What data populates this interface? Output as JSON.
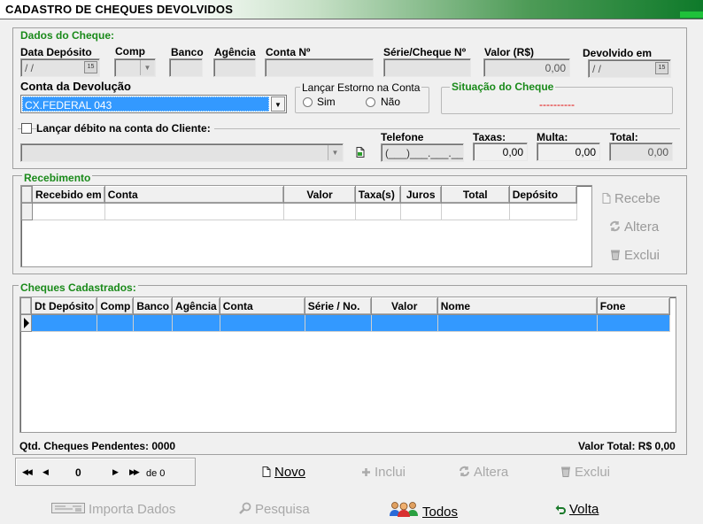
{
  "window": {
    "title": "CADASTRO DE CHEQUES DEVOLVIDOS"
  },
  "cheque": {
    "group_title": "Dados do Cheque:",
    "labels": {
      "data_deposito": "Data Depósito",
      "comp": "Comp",
      "banco": "Banco",
      "agencia": "Agência",
      "conta": "Conta Nº",
      "serie": "Série/Cheque Nº",
      "valor": "Valor (R$)",
      "devolvido": "Devolvido em"
    },
    "values": {
      "data_deposito": "/ /",
      "comp": "",
      "banco": "",
      "agencia": "",
      "conta": "",
      "serie": "",
      "valor": "0,00",
      "devolvido": "/ /"
    },
    "conta_devolucao_label": "Conta da Devolução",
    "conta_devolucao_value": "CX.FEDERAL 043",
    "estorno": {
      "title": "Lançar Estorno na Conta",
      "sim": "Sim",
      "nao": "Não"
    },
    "situacao": {
      "title": "Situação do Cheque",
      "value": "----------"
    }
  },
  "debito": {
    "checkbox_label": "Lançar débito na conta do Cliente:",
    "labels": {
      "telefone": "Telefone",
      "taxas": "Taxas:",
      "multa": "Multa:",
      "total": "Total:"
    },
    "values": {
      "telefone": "(___)___.___.___",
      "taxas": "0,00",
      "multa": "0,00",
      "total": "0,00"
    }
  },
  "recebimento": {
    "group_title": "Recebimento",
    "columns": [
      "Recebido em",
      "Conta",
      "Valor",
      "Taxa(s)",
      "Juros",
      "Total",
      "Depósito"
    ],
    "buttons": {
      "recebe": "Recebe",
      "altera": "Altera",
      "exclui": "Exclui"
    }
  },
  "cadastrados": {
    "group_title": "Cheques Cadastrados:",
    "columns": [
      "Dt Depósito",
      "Comp",
      "Banco",
      "Agência",
      "Conta",
      "Série / No.",
      "Valor",
      "Nome",
      "Fone"
    ],
    "pendentes": "Qtd. Cheques Pendentes: 0000",
    "valor_total": "Valor Total: R$ 0,00"
  },
  "navigator": {
    "first": "◀◀",
    "prev": "◀",
    "current": "0",
    "next": "▶",
    "last": "▶▶",
    "of": "de 0"
  },
  "actions": {
    "novo": "Novo",
    "inclui": "Inclui",
    "altera": "Altera",
    "exclui": "Exclui"
  },
  "footer": {
    "importa": "Importa Dados",
    "pesquisa": "Pesquisa",
    "todos": "Todos",
    "volta": "Volta"
  },
  "colors": {
    "group_title": "#1a8a1a",
    "situacao_value": "#e00000",
    "selection": "#3399ff"
  }
}
